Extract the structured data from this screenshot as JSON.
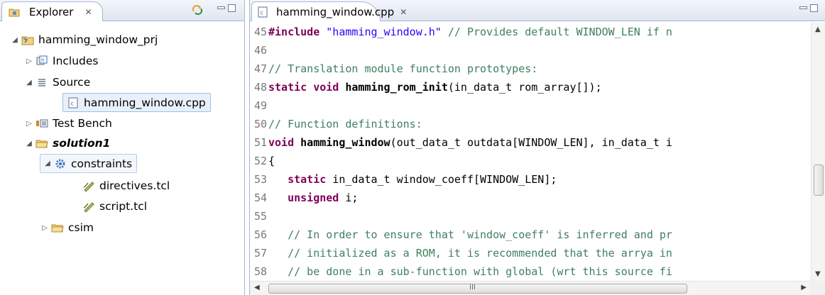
{
  "explorer": {
    "tab_label": "Explorer",
    "close_glyph": "✕",
    "tree": {
      "project": "hamming_window_prj",
      "includes": "Includes",
      "source": "Source",
      "source_file": "hamming_window.cpp",
      "test_bench": "Test Bench",
      "solution": "solution1",
      "constraints": "constraints",
      "directives": "directives.tcl",
      "script": "script.tcl",
      "csim": "csim"
    }
  },
  "editor": {
    "tab_label": "hamming_window.cpp",
    "close_glyph": "✕",
    "lines": [
      {
        "no": "45",
        "parts": [
          {
            "t": "#include",
            "c": "kw"
          },
          {
            "t": " ",
            "c": "src"
          },
          {
            "t": "\"hamming_window.h\"",
            "c": "str"
          },
          {
            "t": " // Provides default WINDOW_LEN if n",
            "c": "cmt"
          }
        ]
      },
      {
        "no": "46",
        "parts": []
      },
      {
        "no": "47",
        "parts": [
          {
            "t": "// Translation module function prototypes:",
            "c": "cmt"
          }
        ]
      },
      {
        "no": "48",
        "parts": [
          {
            "t": "static void ",
            "c": "kw"
          },
          {
            "t": "hamming_rom_init",
            "c": "fn"
          },
          {
            "t": "(in_data_t rom_array[]);",
            "c": "src"
          }
        ]
      },
      {
        "no": "49",
        "parts": []
      },
      {
        "no": "50",
        "parts": [
          {
            "t": "// Function definitions:",
            "c": "cmt"
          }
        ]
      },
      {
        "no": "51",
        "parts": [
          {
            "t": "void ",
            "c": "kw"
          },
          {
            "t": "hamming_window",
            "c": "fn"
          },
          {
            "t": "(out_data_t outdata[WINDOW_LEN], in_data_t i",
            "c": "src"
          }
        ]
      },
      {
        "no": "52",
        "parts": [
          {
            "t": "{",
            "c": "src"
          }
        ]
      },
      {
        "no": "53",
        "parts": [
          {
            "t": "   ",
            "c": "src"
          },
          {
            "t": "static",
            "c": "kw"
          },
          {
            "t": " in_data_t window_coeff[WINDOW_LEN];",
            "c": "src"
          }
        ]
      },
      {
        "no": "54",
        "parts": [
          {
            "t": "   ",
            "c": "src"
          },
          {
            "t": "unsigned",
            "c": "kw"
          },
          {
            "t": " i;",
            "c": "src"
          }
        ]
      },
      {
        "no": "55",
        "parts": []
      },
      {
        "no": "56",
        "parts": [
          {
            "t": "   // In order to ensure that 'window_coeff' is inferred and pr",
            "c": "cmt"
          }
        ]
      },
      {
        "no": "57",
        "parts": [
          {
            "t": "   // initialized as a ROM, it is recommended that the arrya in",
            "c": "cmt"
          }
        ]
      },
      {
        "no": "58",
        "parts": [
          {
            "t": "   // be done in a sub-function with global (wrt this source fi",
            "c": "cmt"
          }
        ]
      }
    ],
    "hscroll_grip": "III"
  }
}
